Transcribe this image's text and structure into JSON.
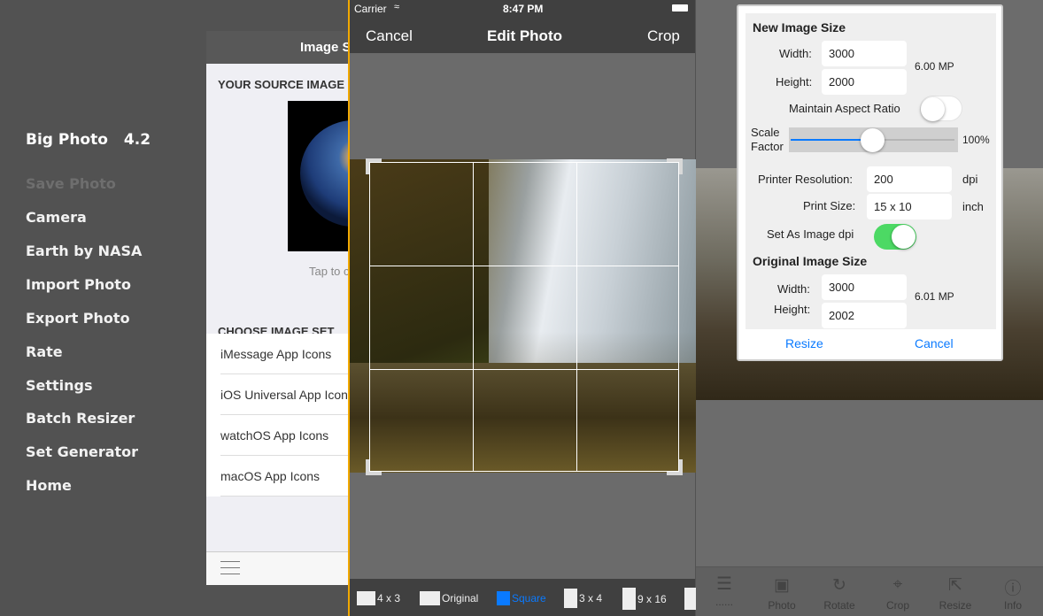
{
  "menu": {
    "app_name": "Big Photo",
    "version": "4.2",
    "items": [
      "Save Photo",
      "Camera",
      "Earth by NASA",
      "Import Photo",
      "Export Photo",
      "Rate",
      "Settings",
      "Batch Resizer",
      "Set Generator",
      "Home"
    ]
  },
  "image_set_panel": {
    "title": "Image S",
    "source_header": "YOUR SOURCE IMAGE",
    "tap_hint": "Tap to c",
    "choose_header": "CHOOSE IMAGE SET",
    "sets": [
      "iMessage App Icons",
      "iOS Universal App Icons",
      "watchOS App Icons",
      "macOS App Icons"
    ]
  },
  "edit_photo": {
    "status": {
      "carrier": "Carrier",
      "time": "8:47 PM"
    },
    "cancel": "Cancel",
    "title": "Edit Photo",
    "crop": "Crop",
    "aspect_ratios": [
      {
        "label": "4 x 3",
        "selected": false
      },
      {
        "label": "Original",
        "selected": false
      },
      {
        "label": "Square",
        "selected": true
      },
      {
        "label": "3 x 4",
        "selected": false
      },
      {
        "label": "9 x 16",
        "selected": false
      }
    ],
    "accent": "#0a7aff"
  },
  "resize_dialog": {
    "new_header": "New Image Size",
    "width_label": "Width:",
    "width": "3000",
    "height_label": "Height:",
    "height": "2000",
    "mp": "6.00 MP",
    "aspect_label": "Maintain Aspect Ratio",
    "aspect_on": false,
    "scale_label_1": "Scale",
    "scale_label_2": "Factor",
    "scale_value": "100%",
    "scale_fraction": 0.5,
    "printer_label": "Printer Resolution:",
    "printer_value": "200",
    "dpi_unit": "dpi",
    "print_size_label": "Print Size:",
    "print_size": "15 x 10",
    "inch_unit": "inch",
    "set_dpi_label": "Set As Image dpi",
    "set_dpi_on": true,
    "orig_header": "Original Image Size",
    "orig_width": "3000",
    "orig_height": "2002",
    "orig_mp": "6.01 MP",
    "resize": "Resize",
    "cancel": "Cancel",
    "toggle_color": "#4cd964"
  },
  "bottom_toolbar": {
    "menu_dots": "......",
    "items": [
      "Photo",
      "Rotate",
      "Crop",
      "Resize",
      "Info"
    ]
  }
}
